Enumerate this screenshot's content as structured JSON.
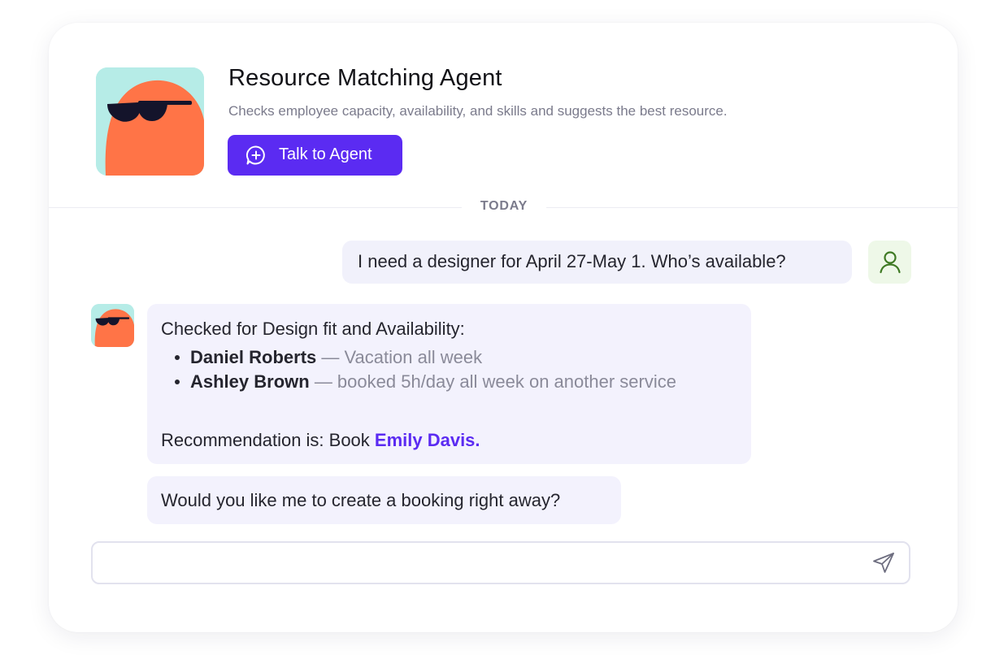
{
  "agent": {
    "title": "Resource Matching Agent",
    "description": "Checks employee capacity, availability, and skills and suggests the best resource.",
    "talk_button_label": "Talk to Agent",
    "avatar_icon": "orange-blob-sunglasses-avatar"
  },
  "divider": {
    "label": "TODAY"
  },
  "messages": {
    "user_1": "I need a designer for April 27-May 1. Who’s available?",
    "bot_1": {
      "intro": "Checked for Design fit and Availability:",
      "items": [
        {
          "name": "Daniel Roberts",
          "detail": " — Vacation all week"
        },
        {
          "name": "Ashley Brown",
          "detail": " — booked 5h/day all week on another service"
        }
      ],
      "recommendation_prefix": "Recommendation is: Book ",
      "recommendation_name": "Emily Davis."
    },
    "bot_2": "Would you like me to create a booking right away?"
  },
  "composer": {
    "placeholder": "",
    "send_icon": "send-icon"
  },
  "colors": {
    "accent": "#5b2bf2",
    "avatar_bg": "#b6ece7",
    "avatar_body": "#ff7447",
    "bubble_bg": "#f3f2fd",
    "user_avatar_bg": "#eef8e8"
  }
}
